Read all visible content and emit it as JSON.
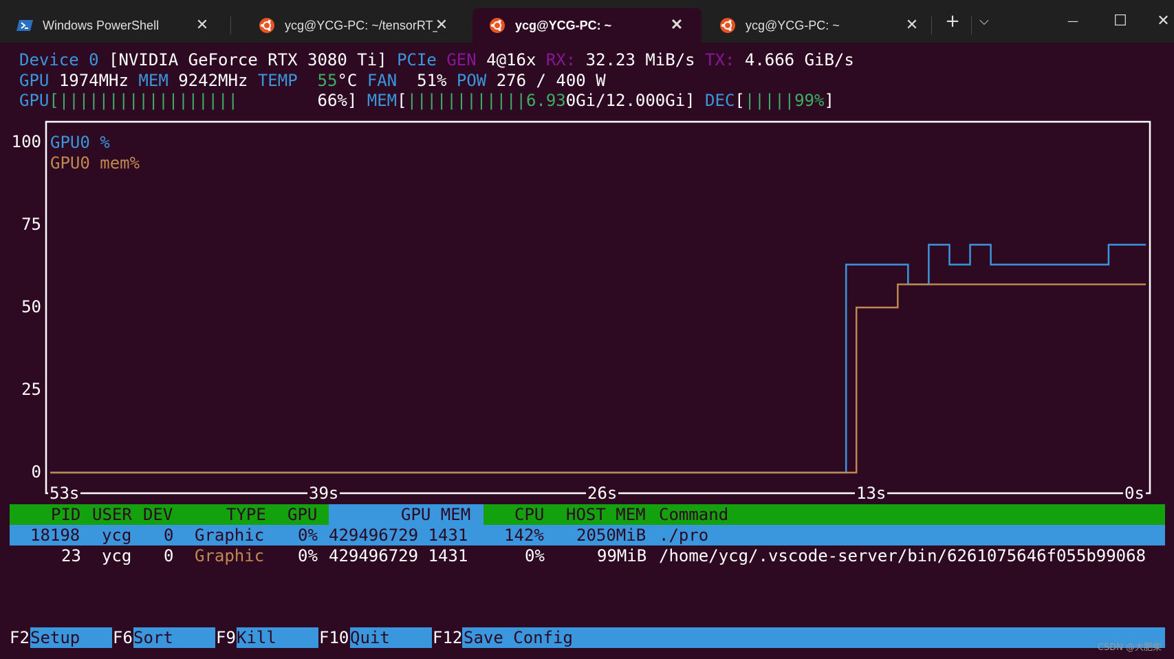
{
  "titlebar": {
    "tabs": [
      {
        "label": "Windows PowerShell",
        "icon": "powershell-icon"
      },
      {
        "label": "ycg@YCG-PC: ~/tensorRT_F",
        "icon": "ubuntu-icon"
      },
      {
        "label": "ycg@YCG-PC: ~",
        "icon": "ubuntu-icon"
      },
      {
        "label": "ycg@YCG-PC: ~",
        "icon": "ubuntu-icon"
      }
    ],
    "active_tab": 2,
    "new_tab": "+",
    "dropdown": "⌵",
    "minimize": "—",
    "maximize": "☐",
    "close": "✕"
  },
  "device": {
    "line1": {
      "device_label": "Device 0",
      "name": "[NVIDIA GeForce RTX 3080 Ti]",
      "pcie_label": "PCIe",
      "gen_label": "GEN",
      "gen_value": "4@16x",
      "rx_label": "RX:",
      "rx_value": "32.23 MiB/s",
      "tx_label": "TX:",
      "tx_value": "4.666 GiB/s"
    },
    "line2": {
      "gpu_label": "GPU",
      "gpu_clock": "1974MHz",
      "mem_label": "MEM",
      "mem_clock": "9242MHz",
      "temp_label": "TEMP",
      "temp_num": "55",
      "temp_unit": "°C",
      "fan_label": "FAN",
      "fan_value": "51%",
      "pow_label": "POW",
      "pow_value": "276 / 400 W"
    },
    "line3": {
      "gpu_label": "GPU",
      "gpu_bar": "[||||||||||||||||||",
      "gpu_pct": "66%]",
      "mem_label": "MEM",
      "mem_bar_open": "[",
      "mem_bar": "||||||||||||",
      "mem_used_green": "6.93",
      "mem_used_rest": "0Gi/12.000Gi]",
      "dec_label": "DEC",
      "dec_open": "[",
      "dec_bar": "|||||99%",
      "dec_close": "]"
    }
  },
  "chart_data": {
    "type": "line",
    "ylim": [
      0,
      100
    ],
    "yticks": [
      "100",
      "75",
      "50",
      "25",
      "0"
    ],
    "xticks": [
      "53s",
      "39s",
      "26s",
      "13s",
      "0s"
    ],
    "x": [
      -53,
      -14.5,
      -14.5,
      -11.5,
      -11.5,
      -10.5,
      -10.5,
      -8.5,
      -8.5,
      -7.5,
      -7.5,
      -6.5,
      -6.5,
      -1.8,
      -1.8,
      0
    ],
    "series": [
      {
        "name": "GPU0 %",
        "color": "#3a96dd",
        "x": [
          -53,
          -14.5,
          -14.5,
          -11.5,
          -11.5,
          -10.5,
          -10.5,
          -9.5,
          -9.5,
          -8.5,
          -8.5,
          -7.5,
          -7.5,
          -1.8,
          -1.8,
          0
        ],
        "values": [
          0,
          0,
          63,
          63,
          57,
          57,
          69,
          69,
          63,
          63,
          69,
          69,
          63,
          63,
          69,
          69
        ]
      },
      {
        "name": "GPU0 mem%",
        "color": "#c0884f",
        "x": [
          -53,
          -14,
          -14,
          -12,
          -12,
          0
        ],
        "values": [
          0,
          0,
          50,
          50,
          57,
          57
        ]
      }
    ]
  },
  "process_table": {
    "headers": {
      "pid": "PID",
      "user": "USER",
      "dev": "DEV",
      "type": "TYPE",
      "gpu": "GPU",
      "gpu_mem": "GPU MEM",
      "cpu": "CPU",
      "host_mem": "HOST MEM",
      "command": "Command"
    },
    "rows": [
      {
        "pid": "18198",
        "user": "ycg",
        "dev": "0",
        "type": "Graphic",
        "gpu": "0%",
        "gpu_mem": "429496729 1431",
        "cpu": "142%",
        "host_mem": "2050MiB",
        "command": "./pro"
      },
      {
        "pid": "23",
        "user": "ycg",
        "dev": "0",
        "type": "Graphic",
        "gpu": "0%",
        "gpu_mem": "429496729 1431",
        "cpu": "0%",
        "host_mem": "99MiB",
        "command": "/home/ycg/.vscode-server/bin/6261075646f055b99068"
      }
    ]
  },
  "function_keys": [
    {
      "key": "F2",
      "label": "Setup"
    },
    {
      "key": "F6",
      "label": "Sort"
    },
    {
      "key": "F9",
      "label": "Kill"
    },
    {
      "key": "F10",
      "label": "Quit"
    },
    {
      "key": "F12",
      "label": "Save Config"
    }
  ],
  "watermark": "CSDN @大肥柴"
}
